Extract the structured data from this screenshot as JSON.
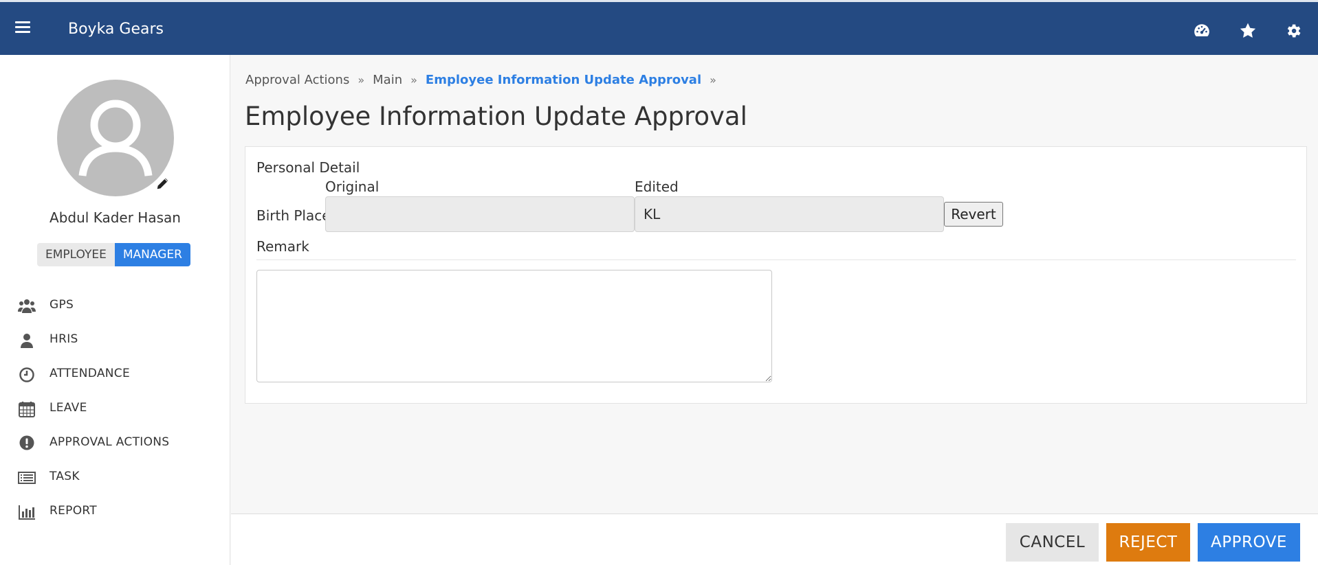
{
  "header": {
    "brand": "Boyka Gears",
    "icons": [
      "menu-icon",
      "dashboard-icon",
      "star-icon",
      "gear-icon"
    ],
    "bar_color": "#244a82"
  },
  "sidebar": {
    "user_name": "Abdul Kader Hasan",
    "roles": {
      "employee": "EMPLOYEE",
      "manager": "MANAGER",
      "active": "MANAGER"
    },
    "items": [
      {
        "label": "GPS",
        "icon": "users-icon"
      },
      {
        "label": "HRIS",
        "icon": "user-icon"
      },
      {
        "label": "ATTENDANCE",
        "icon": "clock-icon"
      },
      {
        "label": "LEAVE",
        "icon": "calendar-icon"
      },
      {
        "label": "APPROVAL ACTIONS",
        "icon": "exclamation-icon"
      },
      {
        "label": "TASK",
        "icon": "list-icon"
      },
      {
        "label": "REPORT",
        "icon": "bar-chart-icon"
      }
    ]
  },
  "breadcrumb": [
    "Approval Actions",
    "Main",
    "Employee Information Update Approval"
  ],
  "page_title": "Employee Information Update Approval",
  "form": {
    "section_title": "Personal Detail",
    "col_original": "Original",
    "col_edited": "Edited",
    "field_label": "Birth Place",
    "original_value": "",
    "edited_value": "KL",
    "revert_label": "Revert",
    "remark_label": "Remark",
    "remark_value": ""
  },
  "actions": {
    "cancel": "CANCEL",
    "reject": "REJECT",
    "approve": "APPROVE",
    "colors": {
      "reject": "#de7b0f",
      "approve": "#2d7fe3",
      "cancel": "#e6e6e6"
    }
  }
}
